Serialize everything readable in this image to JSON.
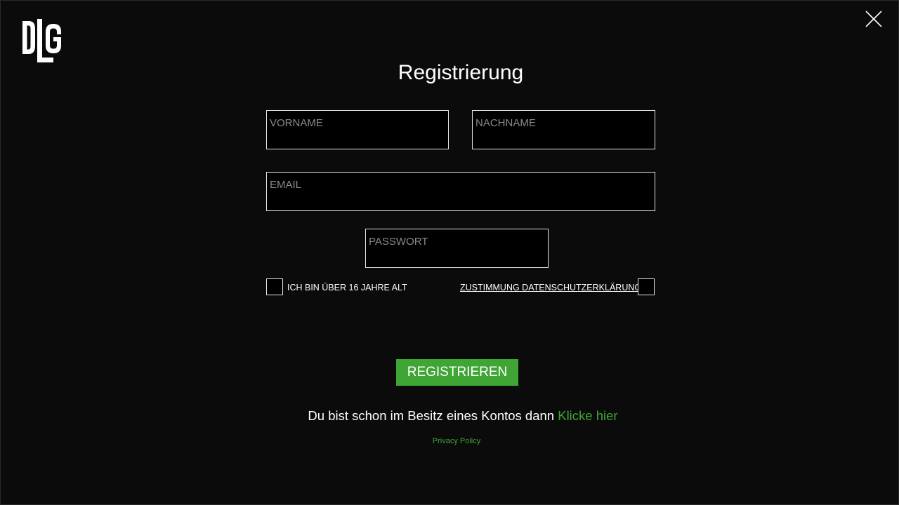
{
  "logo": {
    "text": "DLG",
    "icon": "dlg-logo"
  },
  "close": {
    "icon": "close-icon"
  },
  "form": {
    "title": "Registrierung",
    "fields": {
      "vorname": {
        "placeholder": "VORNAME",
        "value": ""
      },
      "nachname": {
        "placeholder": "NACHNAME",
        "value": ""
      },
      "email": {
        "placeholder": "EMAIL",
        "value": ""
      },
      "passwort": {
        "placeholder": "PASSWORT",
        "value": ""
      }
    },
    "checkboxes": {
      "age": {
        "label": "ICH BIN ÜBER 16 JAHRE ALT",
        "checked": false
      },
      "privacy": {
        "label": "ZUSTIMMUNG DATENSCHUTZERKLÄRUNG",
        "checked": false
      }
    },
    "submit_label": "REGISTRIEREN"
  },
  "login": {
    "text": "Du bist schon im Besitz eines Kontos dann ",
    "link_label": "Klicke hier"
  },
  "footer": {
    "privacy_policy": "Privacy Policy"
  },
  "colors": {
    "background": "#0b0b0b",
    "accent": "#3fa535",
    "field_bg": "#000000",
    "field_border": "#e6e6e6",
    "placeholder": "#8a8a8a"
  }
}
